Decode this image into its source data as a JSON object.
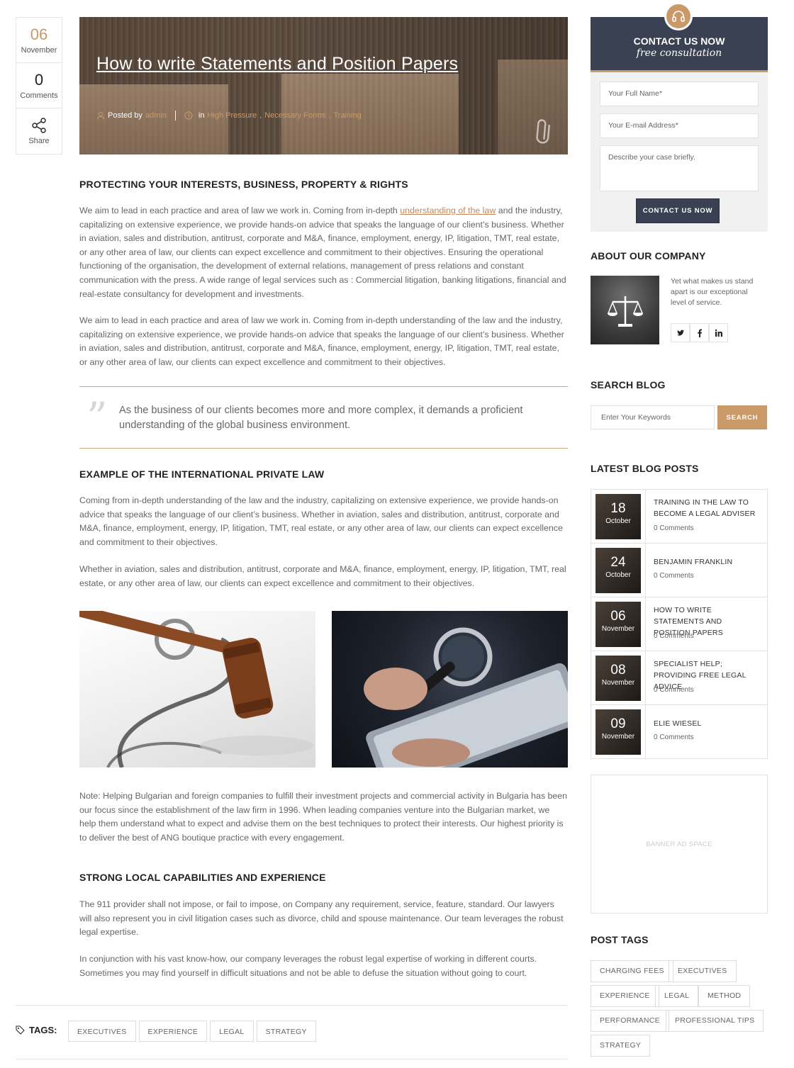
{
  "meta": {
    "day": "06",
    "month": "November",
    "comments_count": "0",
    "comments_label": "Comments",
    "share_label": "Share"
  },
  "hero": {
    "title": "How to write Statements and Position Papers",
    "posted_by_label": "Posted by",
    "author": "admin",
    "in_label": "in",
    "categories": [
      "High Pressure",
      "Necessary Forms",
      "Training"
    ]
  },
  "article": {
    "h1": "PROTECTING YOUR INTERESTS, BUSINESS, PROPERTY & RIGHTS",
    "p1_before": "We aim to lead in each practice and area of law we work in. Coming from in-depth ",
    "p1_link": "understanding of the law",
    "p1_after": " and the industry, capitalizing on extensive experience, we provide hands-on advice that speaks the language of our client’s business. Whether in aviation, sales and distribution, antitrust, corporate and M&A, finance, employment, energy, IP, litigation, TMT, real estate, or any other area of law, our clients can expect excellence and commitment to their objectives. Ensuring the operational functioning of the organisation, the development of external relations, management of press relations and constant communication with the press. A wide range of legal services such as : Commercial litigation, banking litigations, financial and real-estate consultancy for development and investments.",
    "p2": "We aim to lead in each practice and area of law we work in. Coming from in-depth understanding of the law and the industry, capitalizing on extensive experience, we provide hands-on advice that speaks the language of our client’s business. Whether in aviation, sales and distribution, antitrust, corporate and M&A, finance, employment, energy, IP, litigation, TMT, real estate, or any other area of law, our clients can expect excellence and commitment to their objectives.",
    "quote": "As the business of our clients becomes more and more complex, it demands a proficient understanding of the global business environment.",
    "h2": "EXAMPLE OF THE INTERNATIONAL PRIVATE LAW",
    "p3": "Coming from in-depth understanding of the law and the industry, capitalizing on extensive experience, we provide hands-on advice that speaks the language of our client’s business. Whether in aviation, sales and distribution, antitrust, corporate and M&A, finance, employment, energy, IP, litigation, TMT, real estate, or any other area of law, our clients can expect excellence and commitment to their objectives.",
    "p4": "Whether in aviation, sales and distribution, antitrust, corporate and M&A, finance, employment, energy, IP, litigation, TMT, real estate, or any other area of law, our clients can expect excellence and commitment to their objectives.",
    "p5": "Note: Helping Bulgarian and foreign companies to fulfill their investment projects and commercial activity in Bulgaria has been our focus since the establishment of the law firm in 1996. When leading companies venture into the Bulgarian market, we help them understand what to expect and advise them on the best techniques to protect their interests. Our highest priority is to deliver the best of ANG boutique practice with every engagement.",
    "h3": "STRONG LOCAL CAPABILITIES AND EXPERIENCE",
    "p6": "The 911 provider shall not impose, or fail to impose, on Company any requirement, service, feature, standard. Our lawyers will also represent you in civil litigation cases such as divorce, child and spouse maintenance. Our team leverages the robust legal expertise.",
    "p7": "In conjunction with his vast know-how, our company leverages the robust legal expertise of working in different courts. Sometimes you may find yourself in difficult situations and not be able to defuse the situation without going to court."
  },
  "tags": {
    "label": "TAGS:",
    "items": [
      "EXECUTIVES",
      "EXPERIENCE",
      "LEGAL",
      "STRATEGY"
    ]
  },
  "contact": {
    "title": "CONTACT US NOW",
    "subtitle": "free consultation",
    "name_placeholder": "Your Full Name*",
    "email_placeholder": "Your E-mail Address*",
    "case_placeholder": "Describe your case briefly.",
    "button": "CONTACT US NOW"
  },
  "about": {
    "heading": "ABOUT OUR COMPANY",
    "text": "Yet what makes us stand apart is our exceptional level of service.",
    "social": [
      "twitter-icon",
      "facebook-icon",
      "linkedin-icon"
    ]
  },
  "search": {
    "heading": "SEARCH BLOG",
    "placeholder": "Enter Your Keywords",
    "button": "SEARCH"
  },
  "latest": {
    "heading": "LATEST BLOG POSTS",
    "posts": [
      {
        "day": "18",
        "month": "October",
        "title": "TRAINING IN THE LAW TO BECOME A LEGAL ADVISER",
        "comments": "0 Comments"
      },
      {
        "day": "24",
        "month": "October",
        "title": "BENJAMIN FRANKLIN",
        "comments": "0 Comments"
      },
      {
        "day": "06",
        "month": "November",
        "title": "HOW TO WRITE STATEMENTS AND POSITION PAPERS",
        "comments": "0 Comments"
      },
      {
        "day": "08",
        "month": "November",
        "title": "SPECIALIST HELP; PROVIDING FREE LEGAL ADVICE",
        "comments": "0 Comments"
      },
      {
        "day": "09",
        "month": "November",
        "title": "ELIE WIESEL",
        "comments": "0 Comments"
      }
    ]
  },
  "banner": {
    "text": "BANNER AD SPACE"
  },
  "post_tags": {
    "heading": "POST TAGS",
    "items": [
      "CHARGING FEES",
      "EXECUTIVES",
      "EXPERIENCE",
      "LEGAL",
      "METHOD",
      "PERFORMANCE",
      "PROFESSIONAL TIPS",
      "STRATEGY"
    ]
  },
  "colors": {
    "accent": "#c99a68",
    "dark": "#3a4152"
  }
}
